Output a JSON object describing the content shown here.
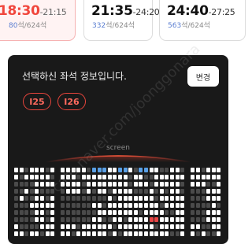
{
  "showtimes": [
    {
      "start": "18:30",
      "end": "-21:15",
      "available": "80",
      "seats_rest": "석/624석",
      "selected": true
    },
    {
      "start": "21:35",
      "end": "-24:20",
      "available": "332",
      "seats_rest": "석/624석",
      "selected": false
    },
    {
      "start": "24:40",
      "end": "-27:25",
      "available": "563",
      "seats_rest": "석/624석",
      "selected": false
    }
  ],
  "panel": {
    "title": "선택하신 좌석 정보입니다.",
    "change_label": "변경",
    "selected_seats": [
      "I25",
      "I26"
    ],
    "screen_label": "screen"
  },
  "watermark": "cafe.naver.com/joonggonara",
  "colors": {
    "accent": "#f0463c",
    "seat_available": "#ffffff",
    "seat_sold": "#4a4a4a",
    "seat_special": "#5aa0e6",
    "seat_selected": "#e84545",
    "panel_bg": "#191919"
  }
}
